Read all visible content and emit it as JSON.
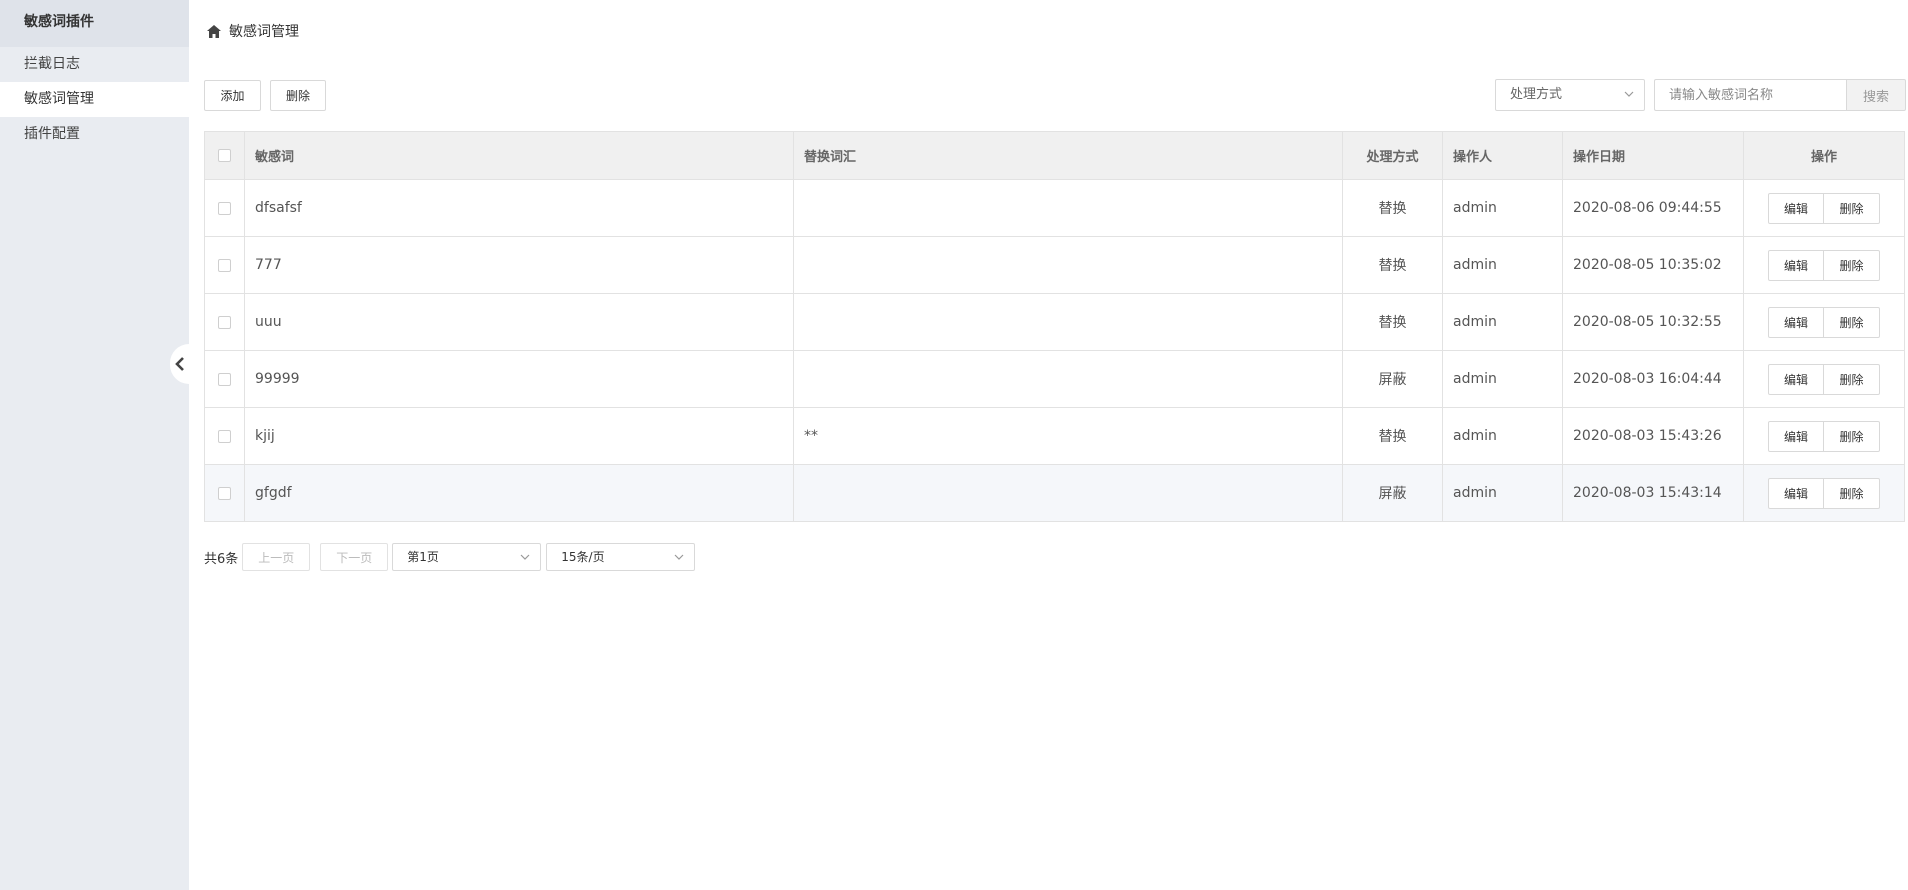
{
  "sidebar": {
    "title": "敏感词插件",
    "items": [
      {
        "label": "拦截日志"
      },
      {
        "label": "敏感词管理"
      },
      {
        "label": "插件配置"
      }
    ]
  },
  "breadcrumb": {
    "label": "敏感词管理",
    "icon": "home-icon"
  },
  "toolbar": {
    "add_label": "添加",
    "delete_label": "删除",
    "mode_select": "处理方式",
    "search_placeholder": "请输入敏感词名称",
    "search_label": "搜索"
  },
  "table": {
    "headers": {
      "word": "敏感词",
      "replacement": "替换词汇",
      "mode": "处理方式",
      "operator": "操作人",
      "date": "操作日期",
      "actions": "操作"
    },
    "rows": [
      {
        "word": "dfsafsf",
        "replacement": "",
        "mode": "替换",
        "operator": "admin",
        "date": "2020-08-06 09:44:55",
        "edit": "编辑",
        "del": "删除"
      },
      {
        "word": "777",
        "replacement": "",
        "mode": "替换",
        "operator": "admin",
        "date": "2020-08-05 10:35:02",
        "edit": "编辑",
        "del": "删除"
      },
      {
        "word": "uuu",
        "replacement": "",
        "mode": "替换",
        "operator": "admin",
        "date": "2020-08-05 10:32:55",
        "edit": "编辑",
        "del": "删除"
      },
      {
        "word": "99999",
        "replacement": "",
        "mode": "屏蔽",
        "operator": "admin",
        "date": "2020-08-03 16:04:44",
        "edit": "编辑",
        "del": "删除"
      },
      {
        "word": "kjij",
        "replacement": "**",
        "mode": "替换",
        "operator": "admin",
        "date": "2020-08-03 15:43:26",
        "edit": "编辑",
        "del": "删除"
      },
      {
        "word": "gfgdf",
        "replacement": "",
        "mode": "屏蔽",
        "operator": "admin",
        "date": "2020-08-03 15:43:14",
        "edit": "编辑",
        "del": "删除"
      }
    ]
  },
  "pager": {
    "total": "共6条",
    "prev": "上一页",
    "next": "下一页",
    "page": "第1页",
    "size": "15条/页"
  },
  "colors": {
    "replace": "#e6a23c",
    "block": "#ee4444",
    "sidebar_bg": "#e9ecf1"
  }
}
